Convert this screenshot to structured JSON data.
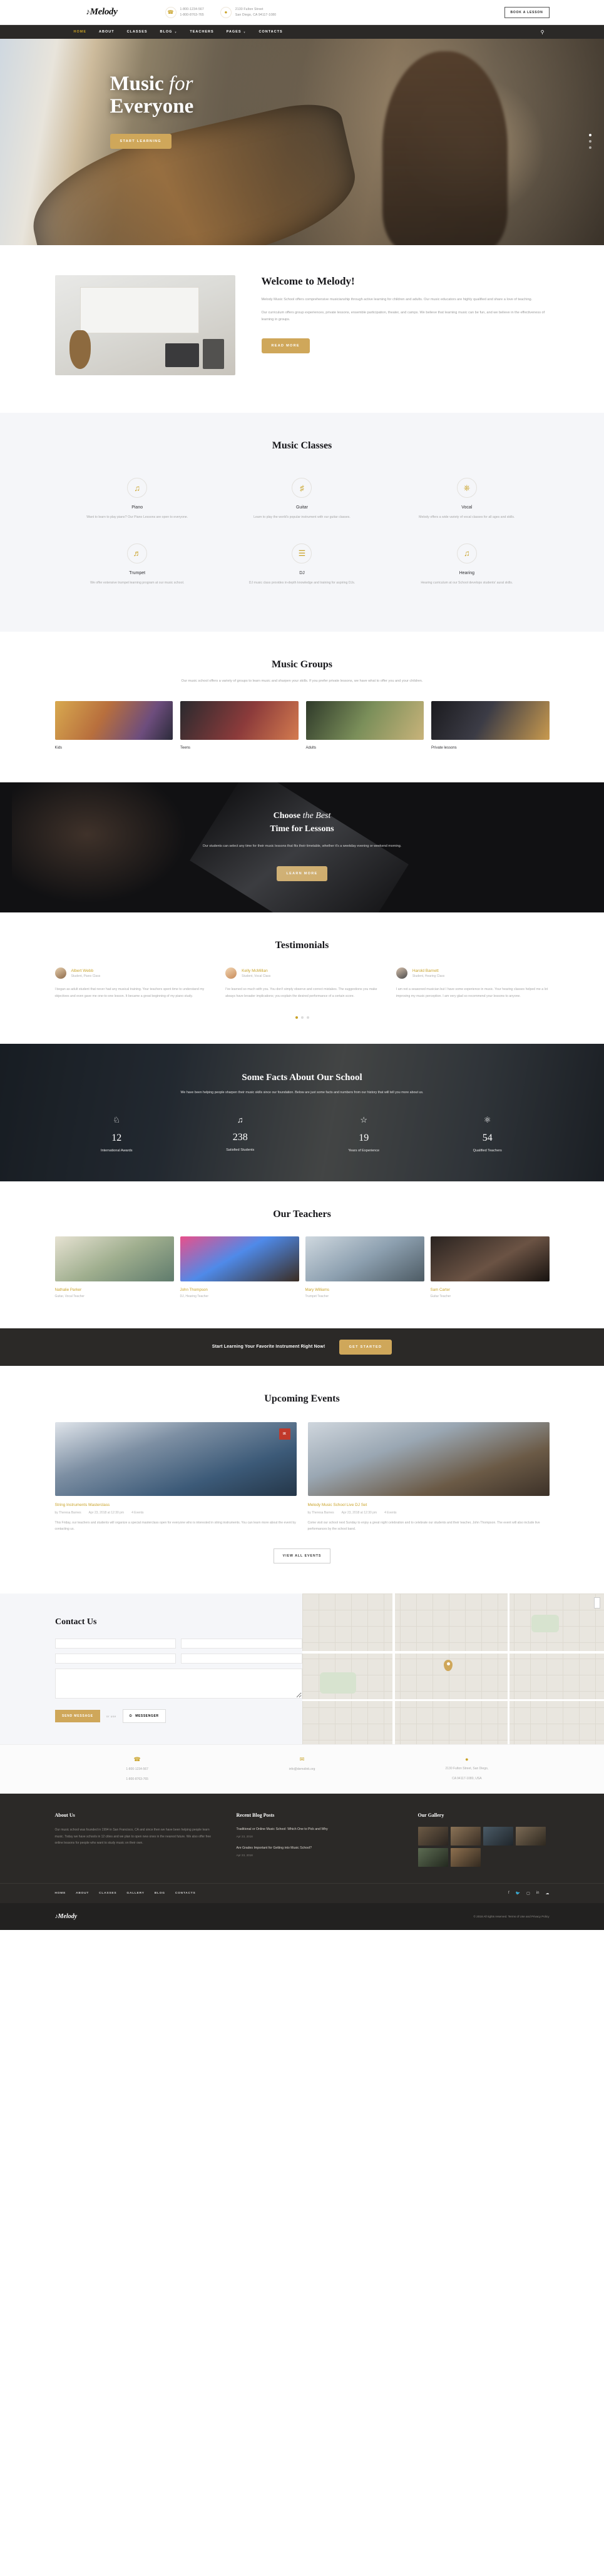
{
  "topbar": {
    "logo": "Melody",
    "phones": [
      "1-800-1234-567",
      "1-800-8763-765"
    ],
    "address": [
      "2130 Fulton Street",
      "San Diego, CA 94117-1080"
    ],
    "book_label": "BOOK A LESSON",
    "phone_icon": "phone-icon",
    "pin_icon": "map-pin-icon"
  },
  "nav": {
    "items": [
      {
        "label": "HOME",
        "active": true,
        "caret": false
      },
      {
        "label": "ABOUT",
        "active": false,
        "caret": false
      },
      {
        "label": "CLASSES",
        "active": false,
        "caret": false
      },
      {
        "label": "BLOG",
        "active": false,
        "caret": true
      },
      {
        "label": "TEACHERS",
        "active": false,
        "caret": false
      },
      {
        "label": "PAGES",
        "active": false,
        "caret": true
      },
      {
        "label": "CONTACTS",
        "active": false,
        "caret": false
      }
    ],
    "search_icon": "search-icon"
  },
  "hero": {
    "title_line1_a": "Music ",
    "title_line1_b": "for",
    "title_line2": "Everyone",
    "cta": "START LEARNING"
  },
  "welcome": {
    "heading": "Welcome to Melody!",
    "p1": "Melody Music School offers comprehensive musicianship through active learning for children and adults. Our music educators are highly qualified and share a love of teaching.",
    "p2": "Our curriculum offers group experiences, private lessons, ensemble participation, theater, and camps. We believe that learning music can be fun, and we believe in the effectiveness of learning in groups.",
    "cta": "READ MORE"
  },
  "classes": {
    "title": "Music Classes",
    "items": [
      {
        "icon": "music-note-icon",
        "glyph": "♫",
        "name": "Piano",
        "desc": "Want to learn to play piano? Our Piano Lessons are open to everyone."
      },
      {
        "icon": "guitar-icon",
        "glyph": "♁",
        "name": "Guitar",
        "desc": "Learn to play the world's popular instrument with our guitar classes."
      },
      {
        "icon": "microphone-icon",
        "glyph": "Ἲ4",
        "name": "Vocal",
        "desc": "Melody offers a wide variety of vocal classes for all ages and skills."
      },
      {
        "icon": "trumpet-icon",
        "glyph": "♬",
        "name": "Trumpet",
        "desc": "We offer extensive trumpet learning program at our music school."
      },
      {
        "icon": "mixer-icon",
        "glyph": "☶",
        "name": "DJ",
        "desc": "DJ music class provides in-depth knowledge and training for aspiring DJs."
      },
      {
        "icon": "ear-icon",
        "glyph": "ʘ",
        "name": "Hearing",
        "desc": "Hearing curriculum at our School develops students' aural skills."
      }
    ]
  },
  "groups": {
    "title": "Music Groups",
    "subtitle": "Our music school offers a variety of groups to learn music and sharpen your skills. If you prefer private lessons, we have what to offer you and your children.",
    "items": [
      {
        "name": "Kids"
      },
      {
        "name": "Teens"
      },
      {
        "name": "Adults"
      },
      {
        "name": "Private lessons"
      }
    ]
  },
  "choose": {
    "title_a": "Choose ",
    "title_em": "the Best",
    "title_b": "Time for Lessons",
    "text": "Our students can select any time for their music lessons that fits their timetable, whether it's a weekday evening or weekend morning.",
    "cta": "LEARN MORE"
  },
  "testimonials": {
    "title": "Testimonials",
    "items": [
      {
        "name": "Albert Webb",
        "role": "Student, Piano Class",
        "text": "I began as adult student that never had any musical training. Your teachers spent time to understand my objectives and even gave me one-to-one lesson. It became a great beginning of my piano study."
      },
      {
        "name": "Kelly McMillan",
        "role": "Student, Vocal Class",
        "text": "I've learned so much with you. You don't simply observe and correct mistakes. The suggestions you make always have broader implications; you explain the desired performance of a certain score."
      },
      {
        "name": "Harold Barnett",
        "role": "Student, Hearing Class",
        "text": "I am not a seasoned musician but I have some experience in music. Your hearing classes helped me a lot improving my music perception. I am very glad so recommend your lessons to anyone."
      }
    ]
  },
  "facts": {
    "title": "Some Facts About Our School",
    "subtitle": "We have been helping people sharpen their music skills since our foundation. Below are just some facts and numbers from our history that will tell you more about us.",
    "items": [
      {
        "icon": "trophy-icon",
        "glyph": "♓",
        "number": "12",
        "label": "International Awards"
      },
      {
        "icon": "music-note-icon",
        "glyph": "♫",
        "number": "238",
        "label": "Satisfied Students"
      },
      {
        "icon": "star-icon",
        "glyph": "☆",
        "number": "19",
        "label": "Years of Experience"
      },
      {
        "icon": "users-icon",
        "glyph": "⛯",
        "number": "54",
        "label": "Qualified Teachers"
      }
    ]
  },
  "teachers": {
    "title": "Our Teachers",
    "items": [
      {
        "name": "Nathalie Parker",
        "role": "Guitar, Vocal Teacher"
      },
      {
        "name": "John Thompson",
        "role": "DJ, Hearing Teacher"
      },
      {
        "name": "Mary Williams",
        "role": "Trumpet Teacher"
      },
      {
        "name": "Sam Carter",
        "role": "Guitar Teacher"
      }
    ]
  },
  "cta_strip": {
    "text": "Start Learning Your Favorite Instrument Right Now!",
    "button": "GET STARTED"
  },
  "events": {
    "title": "Upcoming Events",
    "view_all": "VIEW ALL EVENTS",
    "items": [
      {
        "badge": "IX",
        "title": "String Instruments Masterclass",
        "author": "by Theresa Barnes",
        "date": "Apr 23, 2018 at 12:30 pm",
        "comments": "4 Events",
        "text": "This Friday, our teachers and students will organize a special masterclass open for everyone who is interested in string instruments. You can learn more about the event by contacting us."
      },
      {
        "badge": "",
        "title": "Melody Music School Live DJ Set",
        "author": "by Theresa Barnes",
        "date": "Apr 23, 2018 at 12:30 pm",
        "comments": "4 Events",
        "text": "Come visit our school next Sunday to enjoy a great night celebration and to celebrate our students and their teacher, John Thompson. The event will also include live performances by the school band."
      }
    ]
  },
  "contact": {
    "title": "Contact Us",
    "fields": {
      "name_placeholder": "",
      "email_placeholder": "",
      "subject_placeholder": "",
      "message_placeholder": ""
    },
    "send_label": "SEND MESSAGE",
    "or_label": "or use",
    "messenger_label": "MESSENGER",
    "messenger_icon": "messenger-icon"
  },
  "contact_info": [
    {
      "icon": "phone-icon",
      "glyph": "☎",
      "lines": [
        "1-800-1234-567",
        "1-800-8763-765"
      ]
    },
    {
      "icon": "envelope-icon",
      "glyph": "✉",
      "lines": [
        "info@demolink.org"
      ]
    },
    {
      "icon": "map-pin-icon",
      "glyph": "◉",
      "lines": [
        "2130 Fulton Street, San Diego,",
        "CA 94117-1080, USA"
      ]
    }
  ],
  "footer": {
    "about": {
      "title": "About Us",
      "text": "Our music school was founded in 1994 in San Francisco, CA and since then we have been helping people learn music. Today we have schools in 12 cities and we plan to open new ones in the nearest future. We also offer free online lessons for people who want to study music on their own."
    },
    "blog": {
      "title": "Recent Blog Posts",
      "posts": [
        {
          "title": "Traditional or Online Music School: Which One to Pick and Why",
          "date": "Apr 23, 2018"
        },
        {
          "title": "Are Grades Important for Getting into Music School?",
          "date": "Apr 23, 2018"
        }
      ]
    },
    "gallery": {
      "title": "Our Gallery"
    },
    "nav": [
      "HOME",
      "ABOUT",
      "CLASSES",
      "GALLERY",
      "BLOG",
      "CONTACTS"
    ],
    "social": [
      "facebook-icon",
      "twitter-icon",
      "instagram-icon",
      "linkedin-icon",
      "rss-icon"
    ],
    "logo": "Melody",
    "copyright": "© 2018 All rights reserved. Terms of Use and Privacy Policy"
  },
  "colors": {
    "gold": "#c9a227",
    "gold_btn": "#cfa75a",
    "dark": "#2b2927",
    "light_bg": "#f5f6f9"
  }
}
